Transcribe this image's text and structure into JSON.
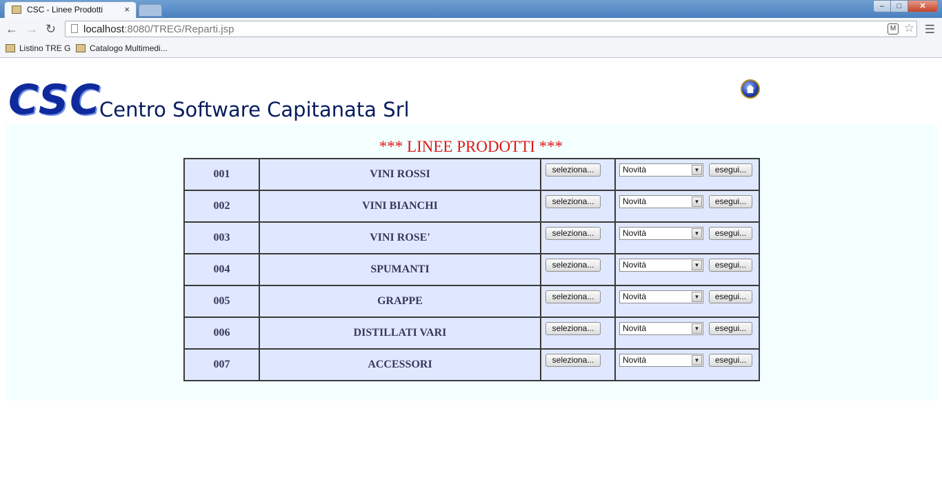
{
  "browser": {
    "tab_title": "CSC - Linee Prodotti",
    "tab_close": "×",
    "url_host": "localhost",
    "url_rest": ":8080/TREG/Reparti.jsp",
    "bookmarks": [
      "Listino TRE G",
      "Catalogo Multimedi..."
    ],
    "window_controls": {
      "minimize": "–",
      "maximize": "□",
      "close": "✕"
    }
  },
  "header": {
    "logo": "CSC",
    "company": "Centro Software Capitanata Srl"
  },
  "page": {
    "title": "*** LINEE PRODOTTI ***"
  },
  "rows": [
    {
      "code": "001",
      "name": "VINI ROSSI",
      "select_label": "seleziona...",
      "dropdown_value": "Novità",
      "run_label": "esegui..."
    },
    {
      "code": "002",
      "name": "VINI BIANCHI",
      "select_label": "seleziona...",
      "dropdown_value": "Novità",
      "run_label": "esegui..."
    },
    {
      "code": "003",
      "name": "VINI ROSE'",
      "select_label": "seleziona...",
      "dropdown_value": "Novità",
      "run_label": "esegui..."
    },
    {
      "code": "004",
      "name": "SPUMANTI",
      "select_label": "seleziona...",
      "dropdown_value": "Novità",
      "run_label": "esegui..."
    },
    {
      "code": "005",
      "name": "GRAPPE",
      "select_label": "seleziona...",
      "dropdown_value": "Novità",
      "run_label": "esegui..."
    },
    {
      "code": "006",
      "name": "DISTILLATI VARI",
      "select_label": "seleziona...",
      "dropdown_value": "Novità",
      "run_label": "esegui..."
    },
    {
      "code": "007",
      "name": "ACCESSORI",
      "select_label": "seleziona...",
      "dropdown_value": "Novità",
      "run_label": "esegui..."
    }
  ],
  "colors": {
    "title_red": "#e01515",
    "cell_bg": "#e0e8ff",
    "panel_bg": "#f4ffff",
    "logo_blue": "#0f2a9c"
  }
}
